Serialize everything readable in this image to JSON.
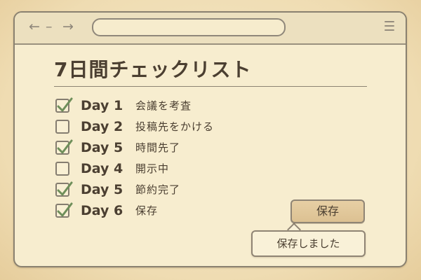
{
  "toolbar": {
    "back_icon": "←",
    "separator": "–",
    "forward_icon": "→",
    "address_value": "",
    "menu_icon": "hamburger-menu-icon"
  },
  "page": {
    "title": "7日間チェックリスト"
  },
  "checklist": {
    "items": [
      {
        "checked": true,
        "day": "Day 1",
        "task": "会議を考査"
      },
      {
        "checked": false,
        "day": "Day 2",
        "task": "投稿先をかける"
      },
      {
        "checked": true,
        "day": "Day 5",
        "task": "時間先了"
      },
      {
        "checked": false,
        "day": "Day 4",
        "task": "開示中"
      },
      {
        "checked": true,
        "day": "Day 5",
        "task": "節約完了"
      },
      {
        "checked": true,
        "day": "Day 6",
        "task": "保存"
      }
    ]
  },
  "actions": {
    "save_label": "保存",
    "toast_message": "保存しました"
  },
  "colors": {
    "check_mark": "#6f8f5a",
    "background": "#f7edcf",
    "toolbar": "#ece0bf",
    "save_button": "#e0c597"
  }
}
